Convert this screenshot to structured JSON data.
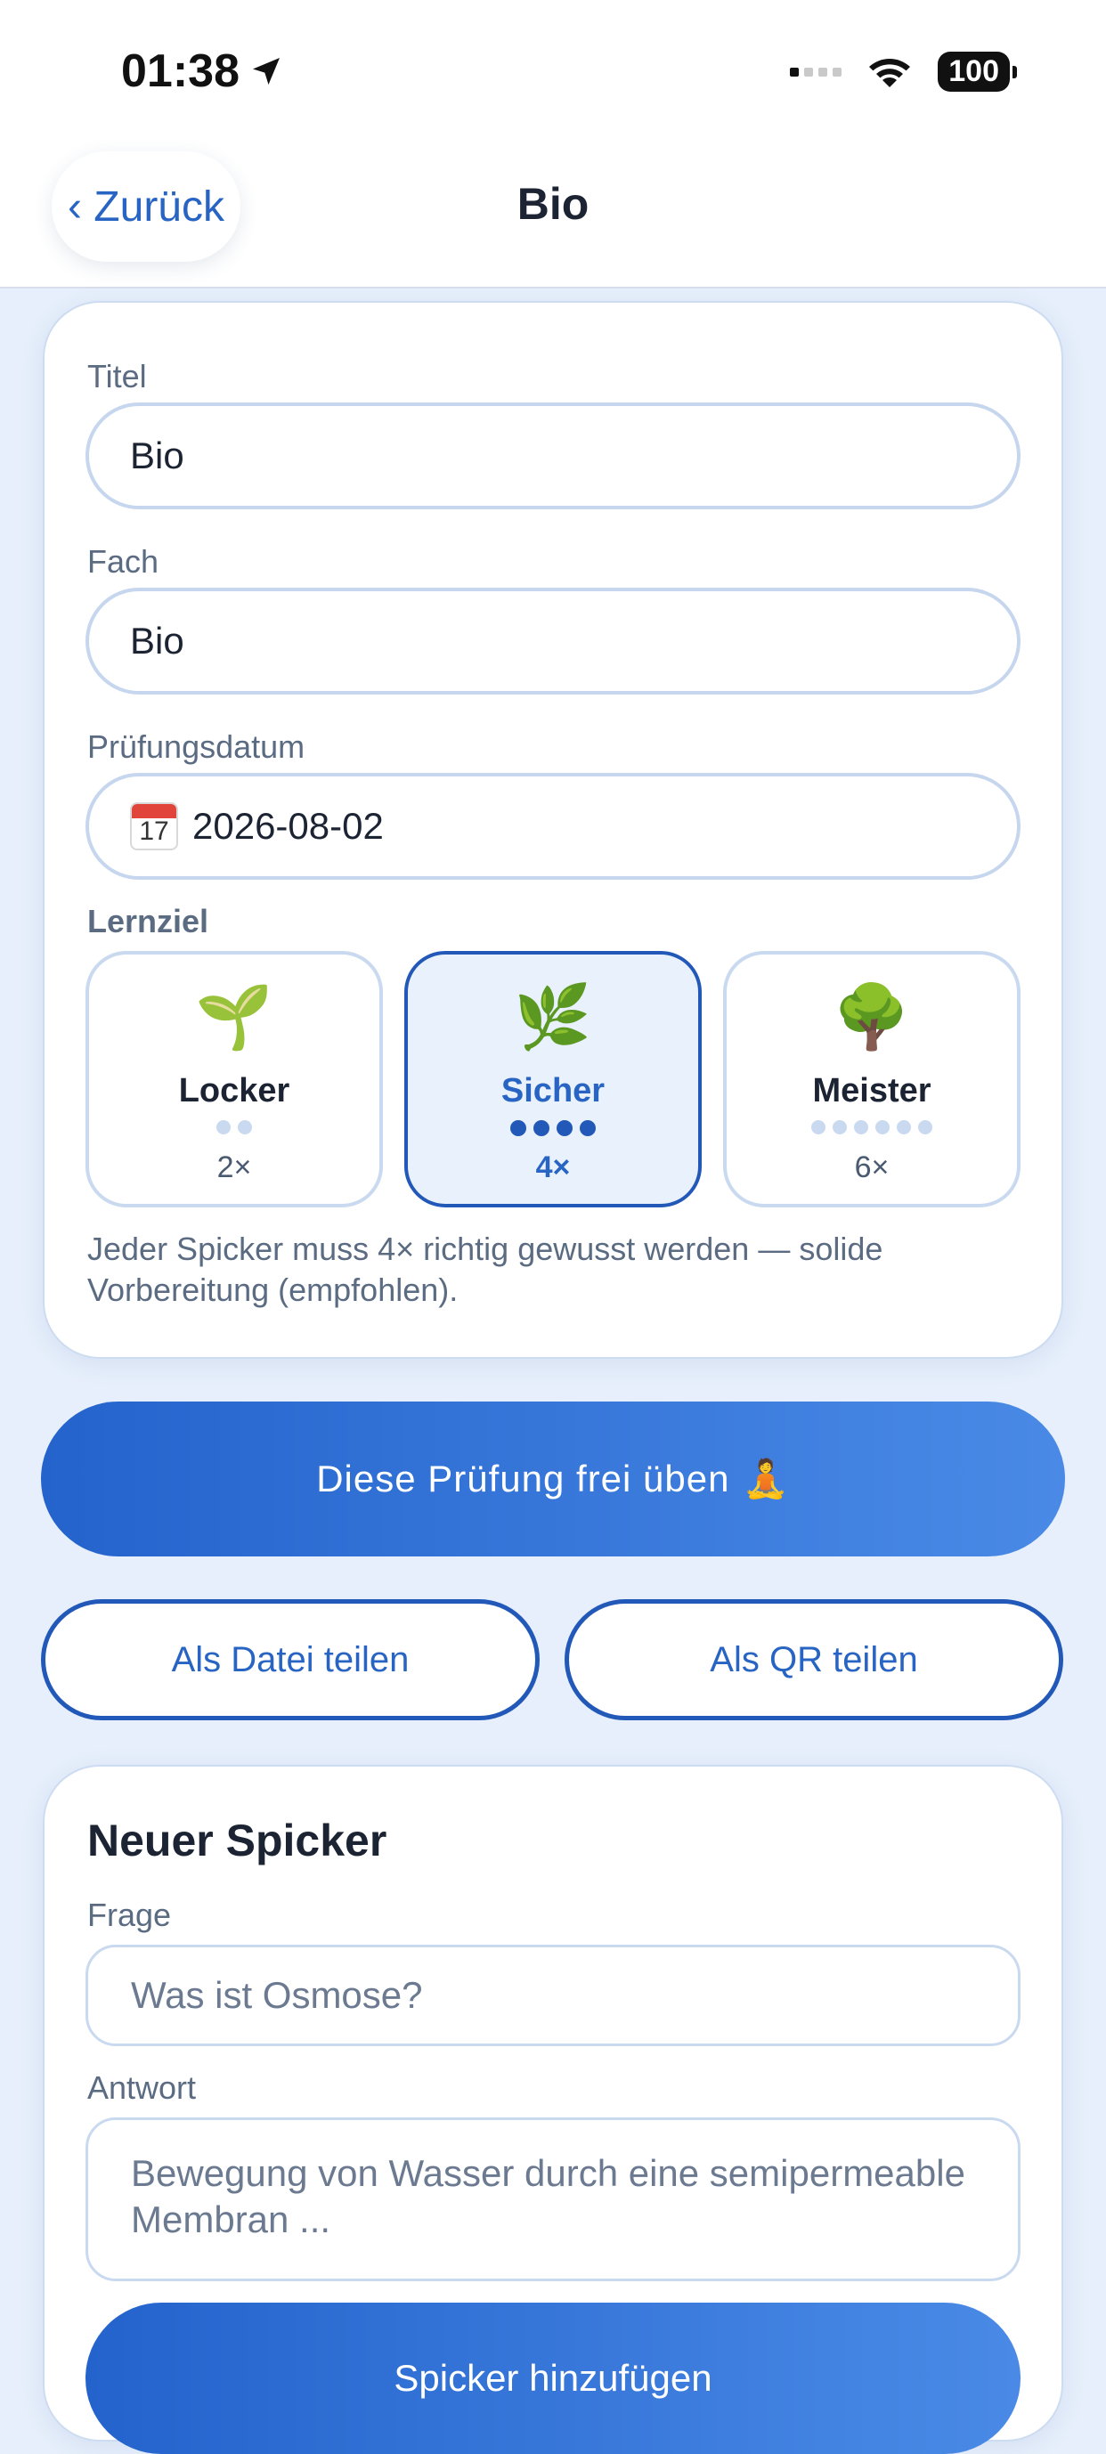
{
  "status_bar": {
    "time": "01:38",
    "battery": "100"
  },
  "nav": {
    "back_label": "‹ Zurück",
    "title": "Bio"
  },
  "form": {
    "title_label": "Titel",
    "title_value": "Bio",
    "subject_label": "Fach",
    "subject_value": "Bio",
    "date_label": "Prüfungsdatum",
    "date_icon_day": "17",
    "date_value": "2026-08-02",
    "goal_label": "Lernziel",
    "goals": [
      {
        "emoji": "🌱",
        "name": "Locker",
        "count": "2×",
        "level": 2,
        "selected": false
      },
      {
        "emoji": "🌿",
        "name": "Sicher",
        "count": "4×",
        "level": 4,
        "selected": true
      },
      {
        "emoji": "🌳",
        "name": "Meister",
        "count": "6×",
        "level": 6,
        "selected": false
      }
    ],
    "goal_description": "Jeder Spicker muss 4× richtig gewusst werden — solide Vorbereitung (empfohlen)."
  },
  "actions": {
    "practice_label": "Diese Prüfung frei üben",
    "practice_emoji": "🧘",
    "share_file_label": "Als Datei teilen",
    "share_qr_label": "Als QR teilen"
  },
  "new_card": {
    "heading": "Neuer Spicker",
    "question_label": "Frage",
    "question_placeholder": "Was ist Osmose?",
    "answer_label": "Antwort",
    "answer_placeholder": "Bewegung von Wasser durch eine semipermeable Membran ...",
    "add_label": "Spicker hinzufügen"
  },
  "colors": {
    "accent": "#2764c3",
    "accent_dark": "#2259b8",
    "gradient_start": "#2463cc",
    "gradient_end": "#4a8ae6",
    "background": "#e6effb"
  }
}
